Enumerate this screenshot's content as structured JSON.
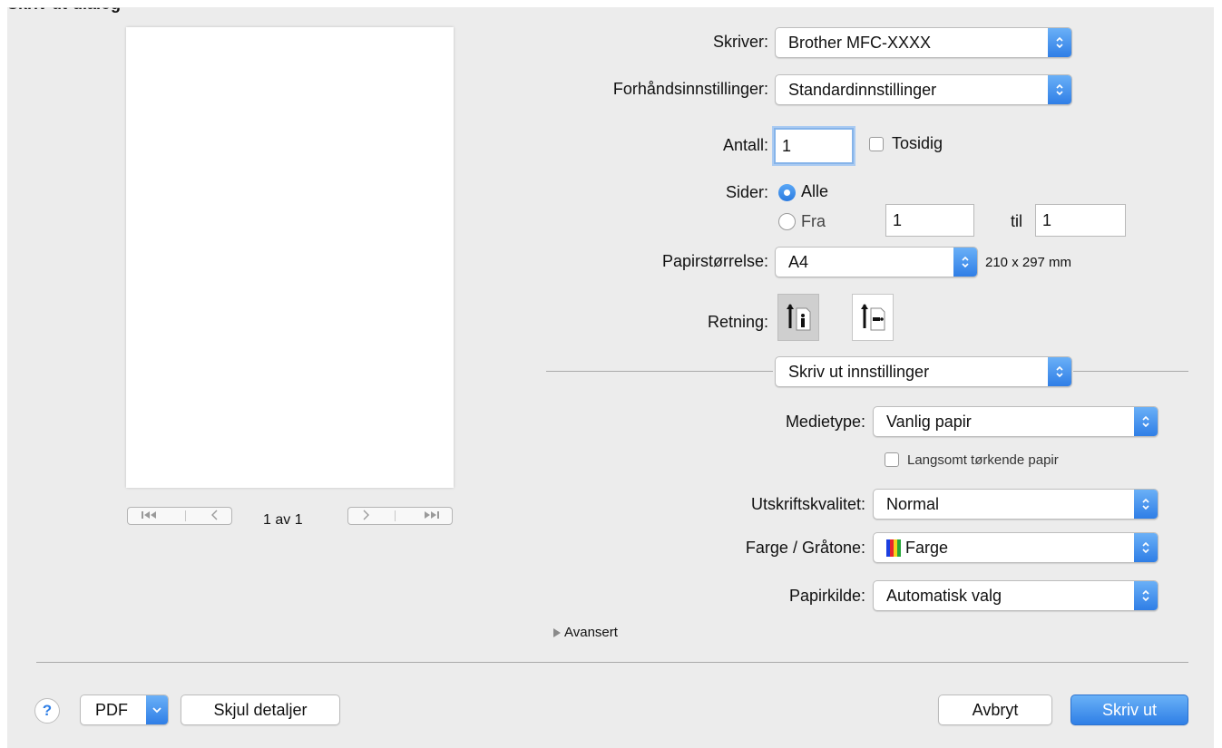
{
  "window": {
    "title_cropped": "Skriv ut-dialog"
  },
  "preview": {
    "page_indicator": "1 av 1",
    "nav_first": "first-page-icon",
    "nav_prev": "previous-page-icon",
    "nav_next": "next-page-icon",
    "nav_last": "last-page-icon"
  },
  "printer": {
    "label": "Skriver:",
    "value": "Brother MFC-XXXX"
  },
  "presets": {
    "label": "Forhåndsinnstillinger:",
    "value": "Standardinnstillinger"
  },
  "copies": {
    "label": "Antall:",
    "value": "1",
    "duplex_label": "Tosidig",
    "duplex_checked": false
  },
  "pages": {
    "label": "Sider:",
    "all_label": "Alle",
    "from_label": "Fra",
    "from_value": "1",
    "to_label": "til",
    "to_value": "1",
    "selected": "all"
  },
  "paper_size": {
    "label": "Papirstørrelse:",
    "value": "A4",
    "dimensions": "210 x 297 mm"
  },
  "orientation": {
    "label": "Retning:",
    "selected": "portrait",
    "icons": [
      "portrait-orientation-icon",
      "landscape-orientation-icon"
    ]
  },
  "section_popup": {
    "value": "Skriv ut innstillinger"
  },
  "settings": {
    "media_type": {
      "label": "Medietype:",
      "value": "Vanlig papir"
    },
    "slow_dry": {
      "label": "Langsomt tørkende papir",
      "checked": false
    },
    "quality": {
      "label": "Utskriftskvalitet:",
      "value": "Normal"
    },
    "color": {
      "label": "Farge / Gråtone:",
      "value": "Farge",
      "swatch_colors": [
        "#1c3fe0",
        "#e9262d",
        "#f6d21c",
        "#27a83b"
      ]
    },
    "paper_source": {
      "label": "Papirkilde:",
      "value": "Automatisk valg"
    },
    "advanced": {
      "label": "Avansert"
    }
  },
  "footer": {
    "help": "?",
    "pdf": "PDF",
    "hide_details": "Skjul detaljer",
    "cancel": "Avbryt",
    "print": "Skriv ut"
  },
  "colors": {
    "accent": "#2f7fe6",
    "panel_bg": "#ececec"
  }
}
